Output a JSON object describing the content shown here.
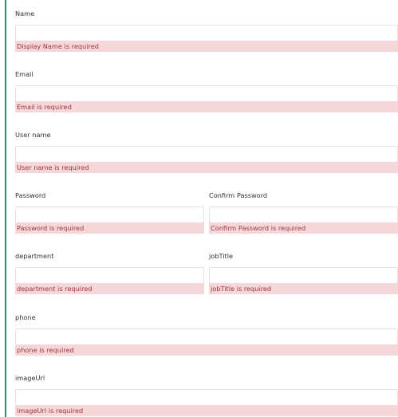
{
  "form": {
    "name": {
      "label": "Name",
      "value": "",
      "error": "Display Name is required"
    },
    "email": {
      "label": "Email",
      "value": "",
      "error": "Email is required"
    },
    "username": {
      "label": "User name",
      "value": "",
      "error": "User name is required"
    },
    "password": {
      "label": "Password",
      "value": "",
      "error": "Password is required"
    },
    "confirm_password": {
      "label": "Confirm Password",
      "value": "",
      "error": "Confirm Password is required"
    },
    "department": {
      "label": "department",
      "value": "",
      "error": "department is required"
    },
    "job_title": {
      "label": "jobTitle",
      "value": "",
      "error": "jobTitle is required"
    },
    "phone": {
      "label": "phone",
      "value": "",
      "error": "phone is required"
    },
    "image_url": {
      "label": "imageUrl",
      "value": "",
      "error": "imageUrl is required"
    }
  },
  "colors": {
    "accent_rule": "#2a8f6a",
    "error_background": "#f6d7d9",
    "error_text": "#a1363d",
    "input_border": "#e3e3e3"
  }
}
